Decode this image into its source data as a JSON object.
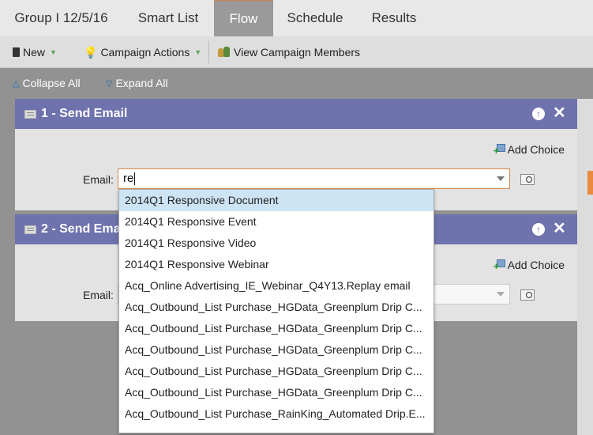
{
  "tabs": [
    {
      "label": "Group I 12/5/16"
    },
    {
      "label": "Smart List"
    },
    {
      "label": "Flow"
    },
    {
      "label": "Schedule"
    },
    {
      "label": "Results"
    }
  ],
  "toolbar": {
    "new_label": "New",
    "campaign_actions_label": "Campaign Actions",
    "view_members_label": "View Campaign Members"
  },
  "collapse_label": "Collapse All",
  "expand_label": "Expand All",
  "steps": [
    {
      "title": "1 - Send Email",
      "add_choice": "Add Choice",
      "field_label": "Email:",
      "field_value": "re"
    },
    {
      "title": "2 - Send Email",
      "add_choice": "Add Choice",
      "field_label": "Email:",
      "field_value": ""
    }
  ],
  "dropdown": {
    "items": [
      "2014Q1 Responsive Document",
      "2014Q1 Responsive Event",
      "2014Q1 Responsive Video",
      "2014Q1 Responsive Webinar",
      "Acq_Online Advertising_IE_Webinar_Q4Y13.Replay email",
      "Acq_Outbound_List Purchase_HGData_Greenplum Drip C...",
      "Acq_Outbound_List Purchase_HGData_Greenplum Drip C...",
      "Acq_Outbound_List Purchase_HGData_Greenplum Drip C...",
      "Acq_Outbound_List Purchase_HGData_Greenplum Drip C...",
      "Acq_Outbound_List Purchase_HGData_Greenplum Drip C...",
      "Acq_Outbound_List Purchase_RainKing_Automated Drip.E..."
    ]
  },
  "colors": {
    "step_header": "#6e72ad",
    "active_input_border": "#d18a4e",
    "highlight": "#cde4f5"
  }
}
